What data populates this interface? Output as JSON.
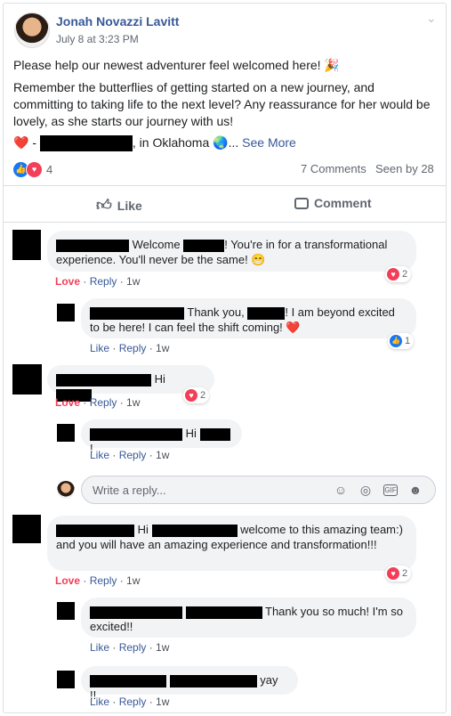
{
  "post": {
    "author": "Jonah Novazzi Lavitt",
    "timestamp": "July 8 at 3:23 PM",
    "paragraph1": "Please help our newest adventurer feel welcomed here! 🎉",
    "paragraph2": "Remember the butterflies of getting started on a new journey, and committing to taking life to the next level? Any reassurance for her would be lovely, as she starts our journey with us!",
    "location_prefix": "❤️ -",
    "location_text": ", in Oklahoma 🌏...",
    "see_more": "See More",
    "reaction_count": "4",
    "comments_count": "7 Comments",
    "seen_by": "Seen by 28",
    "like_label": "Like",
    "comment_label": "Comment"
  },
  "comments": [
    {
      "text_a": "Welcome",
      "text_b": "! You're in for a transformational experience. You'll never be the same! 😁",
      "action": "Love",
      "reply": "Reply",
      "time": "1w",
      "reaction_count": "2"
    },
    {
      "text_a": "Thank you,",
      "text_b": "! I am beyond excited to be here! I can feel the shift coming! ❤️",
      "action": "Like",
      "reply": "Reply",
      "time": "1w",
      "reaction_count": "1"
    },
    {
      "text_a": "Hi",
      "action": "Love",
      "reply": "Reply",
      "time": "1w",
      "reaction_count": "2"
    },
    {
      "text_a": "Hi",
      "text_b": "!",
      "action": "Like",
      "reply": "Reply",
      "time": "1w"
    },
    {
      "text_a": "Hi",
      "text_b": "welcome to this amazing team:) and you will have an amazing experience and transformation!!!",
      "action": "Love",
      "reply": "Reply",
      "time": "1w",
      "reaction_count": "2"
    },
    {
      "text_a": "Thank you so much! I'm so excited!!",
      "action": "Like",
      "reply": "Reply",
      "time": "1w"
    },
    {
      "text_a": "yay !!",
      "action": "Like",
      "reply": "Reply",
      "time": "1w"
    }
  ],
  "reply_box": {
    "placeholder": "Write a reply..."
  },
  "icons": [
    "chevron-down-icon",
    "party-popper-icon",
    "heart-icon",
    "globe-icon",
    "like-thumb-icon",
    "comment-icon",
    "emoji-icon",
    "camera-icon",
    "gif-icon",
    "sticker-icon"
  ],
  "colors": {
    "link": "#385898",
    "love": "#f33e58",
    "like_blue": "#1877f2",
    "bubble": "#f2f3f5"
  }
}
